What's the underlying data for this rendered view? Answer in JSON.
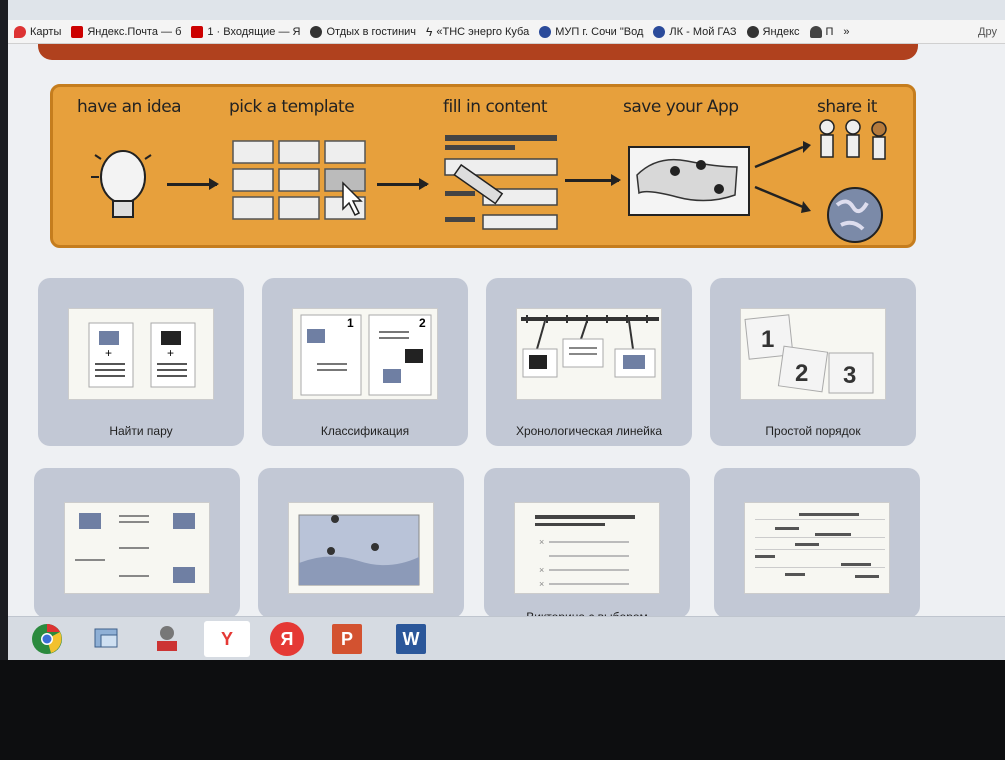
{
  "bookmarks": [
    {
      "label": "Карты",
      "color": "#d33"
    },
    {
      "label": "Яндекс.Почта — б",
      "color": "#c00"
    },
    {
      "label": "1 · Входящие — Я",
      "color": "#c00"
    },
    {
      "label": "Отдых в гостинич",
      "color": "#333"
    },
    {
      "label": "«ТНС энерго Куба",
      "color": "#333"
    },
    {
      "label": "МУП г. Сочи \"Вод",
      "color": "#2a4a9a"
    },
    {
      "label": "ЛК - Мой ГАЗ",
      "color": "#2a4a9a"
    },
    {
      "label": "Яндекс",
      "color": "#333"
    },
    {
      "label": "П",
      "color": "#444"
    }
  ],
  "bookmarks_overflow": "»",
  "bookmarks_other": "Дру",
  "banner_steps": [
    {
      "label": "have an idea"
    },
    {
      "label": "pick a template"
    },
    {
      "label": "fill in content"
    },
    {
      "label": "save your App"
    },
    {
      "label": "share it"
    }
  ],
  "templates": [
    {
      "label": "Найти пару",
      "icon": "pair-match-icon"
    },
    {
      "label": "Классификация",
      "icon": "classification-icon"
    },
    {
      "label": "Хронологическая линейка",
      "icon": "timeline-icon"
    },
    {
      "label": "Простой порядок",
      "icon": "simple-order-icon"
    },
    {
      "label": "",
      "icon": "grid-match-icon"
    },
    {
      "label": "",
      "icon": "map-pins-icon"
    },
    {
      "label": "Викторина с выбором",
      "icon": "quiz-choice-icon"
    },
    {
      "label": "",
      "icon": "cloze-text-icon"
    }
  ],
  "order_numbers": [
    "1",
    "2",
    "3"
  ],
  "classification_numbers": [
    "1",
    "2"
  ],
  "taskbar": [
    {
      "name": "chrome",
      "color": "#2b8a3e"
    },
    {
      "name": "network-tool",
      "color": "#5b7fae"
    },
    {
      "name": "manager",
      "color": "#6a6a6a"
    },
    {
      "name": "yandex-browser",
      "label": "Y",
      "color": "#e53935"
    },
    {
      "name": "yandex",
      "label": "Я",
      "color": "#e53935"
    },
    {
      "name": "powerpoint",
      "label": "P",
      "color": "#d35230"
    },
    {
      "name": "word",
      "label": "W",
      "color": "#2b579a"
    }
  ]
}
